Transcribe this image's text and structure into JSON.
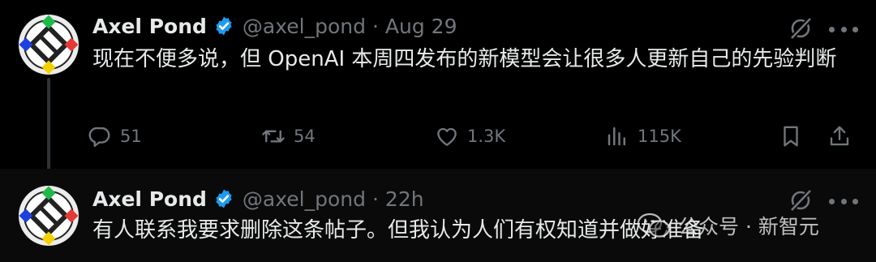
{
  "tweets": [
    {
      "author_name": "Axel Pond",
      "handle": "@axel_pond",
      "separator": "·",
      "time": "Aug 29",
      "text": "现在不便多说，但 OpenAI 本周四发布的新模型会让很多人更新自己的先验判断",
      "stats": {
        "replies": "51",
        "reposts": "54",
        "likes": "1.3K",
        "views": "115K"
      }
    },
    {
      "author_name": "Axel Pond",
      "handle": "@axel_pond",
      "separator": "·",
      "time": "22h",
      "text": "有人联系我要求删除这条帖子。但我认为人们有权知道并做好准备"
    }
  ],
  "watermark": {
    "label": "公众号 · 新智元"
  },
  "icons": {
    "verified": "verified-badge-icon",
    "grok": "grok-icon",
    "more": "more-icon",
    "reply": "reply-icon",
    "repost": "repost-icon",
    "like": "heart-icon",
    "views": "views-icon",
    "bookmark": "bookmark-icon",
    "share": "share-icon"
  },
  "colors": {
    "background": "#000000",
    "text": "#e7e9ea",
    "muted": "#71767b",
    "verified": "#1d9bf0"
  }
}
